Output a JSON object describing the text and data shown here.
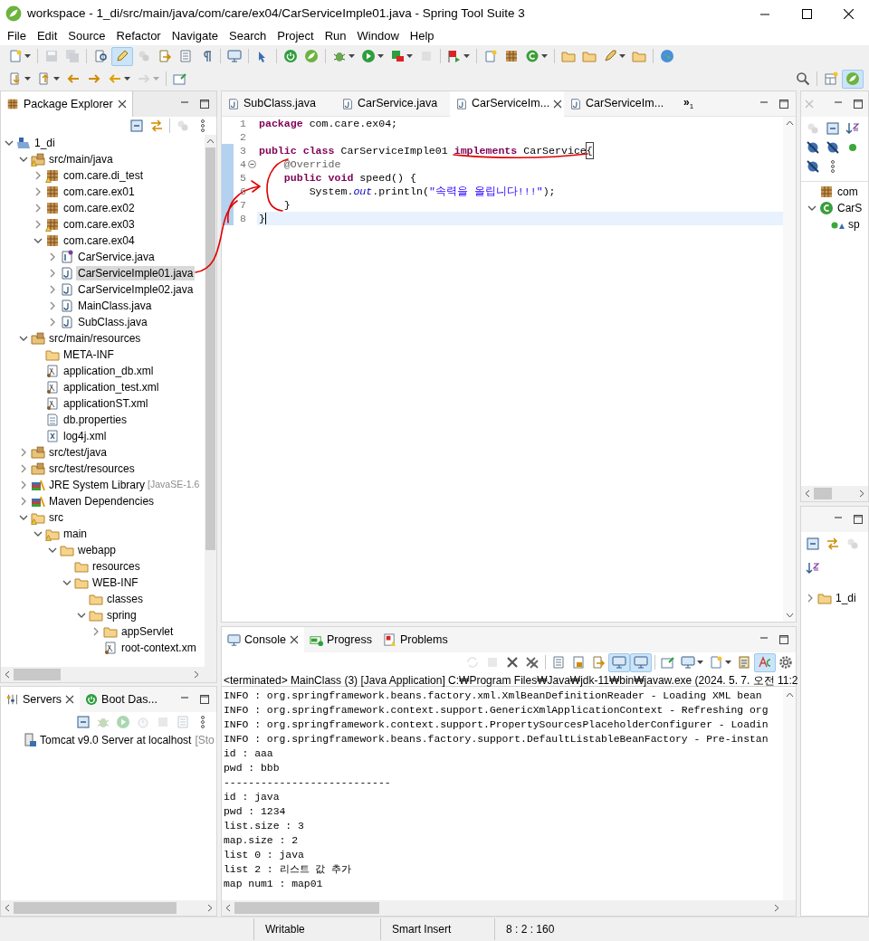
{
  "window": {
    "title": "workspace - 1_di/src/main/java/com/care/ex04/CarServiceImple01.java - Spring Tool Suite 3"
  },
  "menu": [
    "File",
    "Edit",
    "Source",
    "Refactor",
    "Navigate",
    "Search",
    "Project",
    "Run",
    "Window",
    "Help"
  ],
  "toolbar_rows": [
    [
      {
        "kind": "new",
        "dropdown": true,
        "pressed": false,
        "disabled": false
      },
      {
        "kind": "separator"
      },
      {
        "kind": "save",
        "dropdown": false,
        "pressed": false,
        "disabled": true
      },
      {
        "kind": "saveall",
        "dropdown": false,
        "pressed": false,
        "disabled": true
      },
      {
        "kind": "separator"
      },
      {
        "kind": "searchdoc",
        "dropdown": false,
        "pressed": false,
        "disabled": false
      },
      {
        "kind": "pencil",
        "dropdown": false,
        "pressed": true,
        "disabled": false
      },
      {
        "kind": "beans",
        "dropdown": false,
        "pressed": false,
        "disabled": true
      },
      {
        "kind": "docarrow",
        "dropdown": false,
        "pressed": false,
        "disabled": false
      },
      {
        "kind": "doclist",
        "dropdown": false,
        "pressed": false,
        "disabled": false
      },
      {
        "kind": "pilcrow",
        "dropdown": false,
        "pressed": false,
        "disabled": false
      },
      {
        "kind": "separator"
      },
      {
        "kind": "monitor",
        "dropdown": false,
        "pressed": false,
        "disabled": false
      },
      {
        "kind": "separator"
      },
      {
        "kind": "pointer",
        "dropdown": false,
        "pressed": false,
        "disabled": false
      },
      {
        "kind": "separator"
      },
      {
        "kind": "power",
        "dropdown": false,
        "pressed": false,
        "disabled": false
      },
      {
        "kind": "leaf",
        "dropdown": false,
        "pressed": false,
        "disabled": false
      },
      {
        "kind": "separator"
      },
      {
        "kind": "bug",
        "dropdown": true,
        "pressed": false,
        "disabled": false
      },
      {
        "kind": "run",
        "dropdown": true,
        "pressed": false,
        "disabled": false
      },
      {
        "kind": "server",
        "dropdown": true,
        "pressed": false,
        "disabled": false
      },
      {
        "kind": "stop",
        "dropdown": false,
        "pressed": false,
        "disabled": true
      },
      {
        "kind": "separator"
      },
      {
        "kind": "flag",
        "dropdown": true,
        "pressed": false,
        "disabled": false
      },
      {
        "kind": "separator"
      },
      {
        "kind": "docstar",
        "dropdown": false,
        "pressed": false,
        "disabled": false
      },
      {
        "kind": "package",
        "dropdown": false,
        "pressed": false,
        "disabled": false
      },
      {
        "kind": "refresh",
        "dropdown": true,
        "pressed": false,
        "disabled": false
      },
      {
        "kind": "separator"
      },
      {
        "kind": "folder",
        "dropdown": false,
        "pressed": false,
        "disabled": false
      },
      {
        "kind": "folder",
        "dropdown": false,
        "pressed": false,
        "disabled": false
      },
      {
        "kind": "rocket",
        "dropdown": true,
        "pressed": false,
        "disabled": false
      },
      {
        "kind": "folder",
        "dropdown": false,
        "pressed": false,
        "disabled": false
      },
      {
        "kind": "separator"
      },
      {
        "kind": "globe",
        "dropdown": false,
        "pressed": false,
        "disabled": false
      }
    ],
    [
      {
        "kind": "arrowdown",
        "dropdown": true,
        "pressed": false,
        "disabled": false
      },
      {
        "kind": "arrowup",
        "dropdown": true,
        "pressed": false,
        "disabled": false
      },
      {
        "kind": "backstar",
        "dropdown": false,
        "pressed": false,
        "disabled": false
      },
      {
        "kind": "forwardstar",
        "dropdown": false,
        "pressed": false,
        "disabled": false
      },
      {
        "kind": "back",
        "dropdown": true,
        "pressed": false,
        "disabled": false
      },
      {
        "kind": "forward",
        "dropdown": true,
        "pressed": false,
        "disabled": true
      },
      {
        "kind": "separator"
      },
      {
        "kind": "pin",
        "dropdown": false,
        "pressed": false,
        "disabled": false
      }
    ]
  ],
  "toolbar_right": [
    {
      "kind": "search",
      "dropdown": false,
      "pressed": false,
      "disabled": false
    },
    {
      "kind": "separator"
    },
    {
      "kind": "perspective",
      "dropdown": false,
      "pressed": false,
      "disabled": false
    },
    {
      "kind": "leaf",
      "dropdown": false,
      "pressed": true,
      "disabled": false
    }
  ],
  "package_explorer": {
    "tab": {
      "label": "Package Explorer",
      "selected": true
    },
    "toolbar": [
      {
        "kind": "collapse",
        "dropdown": false,
        "pressed": false,
        "disabled": false
      },
      {
        "kind": "swap",
        "dropdown": false,
        "pressed": false,
        "disabled": false
      },
      {
        "kind": "separator"
      },
      {
        "kind": "beans",
        "dropdown": false,
        "pressed": false,
        "disabled": true
      },
      {
        "kind": "dots",
        "dropdown": false,
        "pressed": false,
        "disabled": false
      }
    ],
    "tree": [
      {
        "label": "1_di",
        "kind": "project",
        "warning": false,
        "selected": false,
        "expanded": true,
        "children": [
          {
            "label": "src/main/java",
            "kind": "srcfolder",
            "warning": true,
            "selected": false,
            "expanded": true,
            "children": [
              {
                "label": "com.care.di_test",
                "kind": "package",
                "warning": true,
                "selected": false,
                "expanded": false
              },
              {
                "label": "com.care.ex01",
                "kind": "package",
                "warning": false,
                "selected": false,
                "expanded": false
              },
              {
                "label": "com.care.ex02",
                "kind": "package",
                "warning": false,
                "selected": false,
                "expanded": false
              },
              {
                "label": "com.care.ex03",
                "kind": "package",
                "warning": true,
                "selected": false,
                "expanded": false
              },
              {
                "label": "com.care.ex04",
                "kind": "package",
                "warning": false,
                "selected": false,
                "expanded": true,
                "children": [
                  {
                    "label": "CarService.java",
                    "kind": "interface",
                    "warning": false,
                    "selected": false,
                    "expanded": false
                  },
                  {
                    "label": "CarServiceImple01.java",
                    "kind": "class",
                    "warning": false,
                    "selected": true,
                    "expanded": false
                  },
                  {
                    "label": "CarServiceImple02.java",
                    "kind": "class",
                    "warning": false,
                    "selected": false,
                    "expanded": false
                  },
                  {
                    "label": "MainClass.java",
                    "kind": "class",
                    "warning": false,
                    "selected": false,
                    "expanded": false
                  },
                  {
                    "label": "SubClass.java",
                    "kind": "class",
                    "warning": false,
                    "selected": false,
                    "expanded": false
                  }
                ]
              }
            ]
          },
          {
            "label": "src/main/resources",
            "kind": "srcfolder",
            "warning": false,
            "selected": false,
            "expanded": true,
            "children": [
              {
                "label": "META-INF",
                "kind": "folder",
                "warning": false,
                "selected": false
              },
              {
                "label": "application_db.xml",
                "kind": "beansxml",
                "warning": false,
                "selected": false
              },
              {
                "label": "application_test.xml",
                "kind": "beansxml",
                "warning": false,
                "selected": false
              },
              {
                "label": "applicationST.xml",
                "kind": "beansxml",
                "warning": false,
                "selected": false
              },
              {
                "label": "db.properties",
                "kind": "properties",
                "warning": false,
                "selected": false
              },
              {
                "label": "log4j.xml",
                "kind": "xml",
                "warning": false,
                "selected": false
              }
            ]
          },
          {
            "label": "src/test/java",
            "kind": "srcfolder",
            "warning": false,
            "selected": false,
            "expanded": false
          },
          {
            "label": "src/test/resources",
            "kind": "srcfolder",
            "warning": false,
            "selected": false,
            "expanded": false
          },
          {
            "label": "JRE System Library",
            "decoration": "[JavaSE-1.6",
            "kind": "library",
            "warning": false,
            "selected": false,
            "expanded": false
          },
          {
            "label": "Maven Dependencies",
            "kind": "library",
            "warning": false,
            "selected": false,
            "expanded": false
          },
          {
            "label": "src",
            "kind": "folder",
            "warning": true,
            "selected": false,
            "expanded": true,
            "children": [
              {
                "label": "main",
                "kind": "folder",
                "warning": true,
                "selected": false,
                "expanded": true,
                "children": [
                  {
                    "label": "webapp",
                    "kind": "folder",
                    "warning": false,
                    "selected": false,
                    "expanded": true,
                    "children": [
                      {
                        "label": "resources",
                        "kind": "folder",
                        "warning": false,
                        "selected": false
                      },
                      {
                        "label": "WEB-INF",
                        "kind": "folder",
                        "warning": false,
                        "selected": false,
                        "expanded": true,
                        "children": [
                          {
                            "label": "classes",
                            "kind": "folder",
                            "warning": false,
                            "selected": false
                          },
                          {
                            "label": "spring",
                            "kind": "folder",
                            "warning": false,
                            "selected": false,
                            "expanded": true,
                            "children": [
                              {
                                "label": "appServlet",
                                "kind": "folder",
                                "warning": false,
                                "selected": false,
                                "expanded": false
                              },
                              {
                                "label": "root-context.xm",
                                "kind": "beansxml",
                                "warning": false,
                                "selected": false
                              }
                            ]
                          }
                        ]
                      }
                    ]
                  }
                ]
              }
            ]
          }
        ]
      }
    ]
  },
  "servers": {
    "tabs": [
      {
        "label": "Servers",
        "kind": "servers",
        "selected": true
      },
      {
        "label": "Boot Das...",
        "kind": "boot",
        "selected": false
      }
    ],
    "toolbar": [
      {
        "kind": "collapse",
        "dropdown": false,
        "pressed": false,
        "disabled": false
      },
      {
        "kind": "bug",
        "dropdown": false,
        "pressed": false,
        "disabled": true
      },
      {
        "kind": "run",
        "dropdown": false,
        "pressed": false,
        "disabled": true
      },
      {
        "kind": "clock",
        "dropdown": false,
        "pressed": false,
        "disabled": true
      },
      {
        "kind": "stop",
        "dropdown": false,
        "pressed": false,
        "disabled": true
      },
      {
        "kind": "doclist",
        "dropdown": false,
        "pressed": false,
        "disabled": true
      },
      {
        "kind": "dots",
        "dropdown": false,
        "pressed": false,
        "disabled": false
      }
    ],
    "items": [
      {
        "label": "Tomcat v9.0 Server at localhost",
        "decoration": "[Sto"
      }
    ]
  },
  "editor": {
    "tabs": [
      {
        "label": "SubClass.java",
        "selected": false
      },
      {
        "label": "CarService.java",
        "selected": false
      },
      {
        "label": "CarServiceIm...",
        "selected": true
      },
      {
        "label": "CarServiceIm...",
        "selected": false
      }
    ],
    "overflow": "»",
    "overflow_count": "1",
    "lines": [
      {
        "number": "1",
        "current": false,
        "fold": false,
        "changed": false,
        "segments": [
          {
            "kind": "kw",
            "text": "package"
          },
          {
            "kind": "plain",
            "text": " com.care.ex04;"
          }
        ]
      },
      {
        "number": "2",
        "current": false,
        "fold": false,
        "changed": false
      },
      {
        "number": "3",
        "current": false,
        "fold": false,
        "changed": true,
        "segments": [
          {
            "kind": "kw",
            "text": "public class"
          },
          {
            "kind": "plain",
            "text": " CarServiceImple01 "
          },
          {
            "kind": "kw",
            "text": "implements"
          },
          {
            "kind": "plain",
            "text": " CarService"
          },
          {
            "kind": "match",
            "text": "{"
          }
        ]
      },
      {
        "number": "4",
        "current": false,
        "fold": true,
        "changed": true,
        "segments": [
          {
            "kind": "ann",
            "text": "    @Override"
          }
        ]
      },
      {
        "number": "5",
        "current": false,
        "fold": false,
        "changed": true,
        "segments": [
          {
            "kind": "kw",
            "text": "    public void"
          },
          {
            "kind": "plain",
            "text": " speed() {"
          }
        ]
      },
      {
        "number": "6",
        "current": false,
        "fold": false,
        "changed": true,
        "segments": [
          {
            "kind": "plain",
            "text": "        System."
          },
          {
            "kind": "field",
            "text": "out"
          },
          {
            "kind": "plain",
            "text": ".println("
          },
          {
            "kind": "str",
            "text": "\"속력을 올립니다!!!\""
          },
          {
            "kind": "plain",
            "text": ");"
          }
        ]
      },
      {
        "number": "7",
        "current": false,
        "fold": false,
        "changed": true,
        "segments": [
          {
            "kind": "plain",
            "text": "    }"
          }
        ]
      },
      {
        "number": "8",
        "current": true,
        "fold": false,
        "changed": true,
        "segments": [
          {
            "kind": "plain",
            "text": "}"
          }
        ]
      }
    ]
  },
  "console": {
    "tabs": [
      {
        "label": "Console",
        "kind": "console",
        "selected": true
      },
      {
        "label": "Progress",
        "kind": "progress",
        "selected": false
      },
      {
        "label": "Problems",
        "kind": "problems",
        "selected": false
      }
    ],
    "toolbar": [
      {
        "kind": "sync",
        "dropdown": false,
        "pressed": false,
        "disabled": true
      },
      {
        "kind": "stop",
        "dropdown": false,
        "pressed": false,
        "disabled": true
      },
      {
        "kind": "remove",
        "dropdown": false,
        "pressed": false,
        "disabled": false
      },
      {
        "kind": "removeall",
        "dropdown": false,
        "pressed": false,
        "disabled": false
      },
      {
        "kind": "separator"
      },
      {
        "kind": "doclist",
        "dropdown": false,
        "pressed": false,
        "disabled": false
      },
      {
        "kind": "lock",
        "dropdown": false,
        "pressed": false,
        "disabled": false
      },
      {
        "kind": "docarrow",
        "dropdown": false,
        "pressed": false,
        "disabled": false
      },
      {
        "kind": "monitor",
        "dropdown": false,
        "pressed": true,
        "disabled": false
      },
      {
        "kind": "monitor",
        "dropdown": false,
        "pressed": true,
        "disabled": false
      },
      {
        "kind": "separator"
      },
      {
        "kind": "pin",
        "dropdown": false,
        "pressed": false,
        "disabled": false
      },
      {
        "kind": "monitor",
        "dropdown": true,
        "pressed": false,
        "disabled": false
      },
      {
        "kind": "new",
        "dropdown": true,
        "pressed": false,
        "disabled": false
      },
      {
        "kind": "clipboard",
        "dropdown": false,
        "pressed": false,
        "disabled": false
      },
      {
        "kind": "highlight",
        "dropdown": false,
        "pressed": true,
        "disabled": false
      },
      {
        "kind": "gear",
        "dropdown": false,
        "pressed": false,
        "disabled": false
      }
    ],
    "header": "<terminated> MainClass (3) [Java Application] C:₩Program Files₩Java₩jdk-11₩bin₩javaw.exe  (2024. 5. 7. 오전 11:2",
    "lines": [
      "INFO : org.springframework.beans.factory.xml.XmlBeanDefinitionReader - Loading XML bean",
      "INFO : org.springframework.context.support.GenericXmlApplicationContext - Refreshing org",
      "INFO : org.springframework.context.support.PropertySourcesPlaceholderConfigurer - Loadin",
      "INFO : org.springframework.beans.factory.support.DefaultListableBeanFactory - Pre-instan",
      "id : aaa",
      "pwd : bbb",
      "---------------------------",
      "id : java",
      "pwd : 1234",
      "list.size : 3",
      "map.size : 2",
      "list 0 : java",
      "list 2 : 리스트 값 추가",
      "map num1 : map01"
    ]
  },
  "outline": {
    "toolbar": [
      {
        "kind": "beans",
        "dropdown": false,
        "pressed": false,
        "disabled": true
      },
      {
        "kind": "collapse",
        "dropdown": false,
        "pressed": false,
        "disabled": false
      },
      {
        "kind": "sort",
        "dropdown": false,
        "pressed": false,
        "disabled": false
      },
      {
        "kind": "blocked",
        "dropdown": false,
        "pressed": false,
        "disabled": false
      },
      {
        "kind": "blocked",
        "dropdown": false,
        "pressed": false,
        "disabled": false
      },
      {
        "kind": "dot",
        "dropdown": false,
        "pressed": false,
        "disabled": false
      },
      {
        "kind": "blocked",
        "dropdown": false,
        "pressed": false,
        "disabled": false
      },
      {
        "kind": "dots",
        "dropdown": false,
        "pressed": false,
        "disabled": false
      }
    ],
    "tree": [
      {
        "label": "com",
        "kind": "package",
        "warning": false,
        "selected": false
      },
      {
        "label": "CarS",
        "kind": "classc",
        "warning": false,
        "selected": false,
        "expanded": true,
        "children": [
          {
            "label": "sp",
            "kind": "method",
            "warning": false,
            "selected": false
          }
        ]
      }
    ]
  },
  "navigator": {
    "toolbar": [
      {
        "kind": "collapse",
        "dropdown": false,
        "pressed": false,
        "disabled": false
      },
      {
        "kind": "swap",
        "dropdown": false,
        "pressed": false,
        "disabled": false
      },
      {
        "kind": "beans",
        "dropdown": false,
        "pressed": false,
        "disabled": true
      },
      {
        "kind": "sort",
        "dropdown": false,
        "pressed": false,
        "disabled": false
      }
    ],
    "tree": [
      {
        "label": "1_di",
        "kind": "folder",
        "warning": false,
        "selected": false,
        "expanded": false
      }
    ]
  },
  "status_bar": [
    "Writable",
    "Smart Insert",
    "8 : 2 : 160"
  ]
}
